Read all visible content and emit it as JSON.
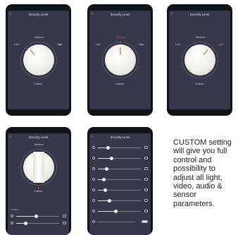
{
  "screens": [
    {
      "title": "Security Level",
      "mode_top": "Medium",
      "mode_left": "Low",
      "mode_right": "High",
      "mode_bottom": "Custom"
    },
    {
      "title": "Security Level",
      "mode_top": "Medium",
      "mode_left": "Low",
      "mode_right": "High",
      "mode_bottom": "Custom"
    },
    {
      "title": "Security Level",
      "mode_top": "Medium",
      "mode_left": "Low",
      "mode_right": "High",
      "mode_bottom": "Custom"
    },
    {
      "title": "Security Level",
      "mode_top": "Medium",
      "mode_bottom": "Custom",
      "section_label": "Custom"
    },
    {
      "title": "Security Level"
    }
  ],
  "description": "CUSTOM setting will give you full control and possibility to adjust all light, video, audio & sensor parameters.",
  "colors": {
    "screen_bg": "#35394a",
    "phone_frame": "#111418",
    "accent": "#e45a48"
  }
}
